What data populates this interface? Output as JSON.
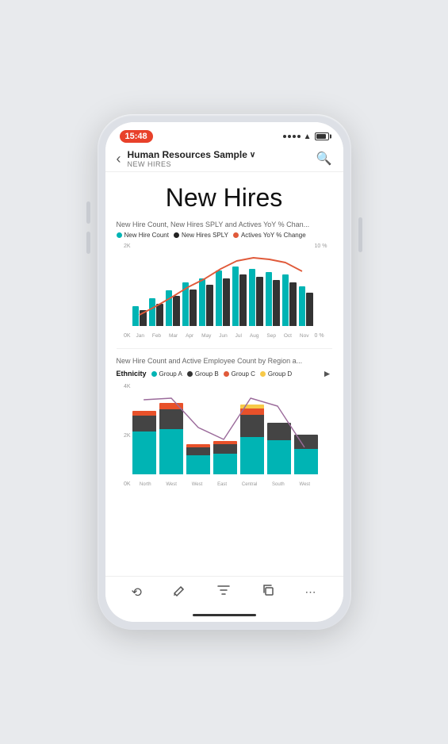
{
  "status": {
    "time": "15:48"
  },
  "nav": {
    "title": "Human Resources Sample",
    "subtitle": "NEW HIRES",
    "back_label": "<",
    "chevron": "∨"
  },
  "page": {
    "title": "New Hires"
  },
  "chart1": {
    "title": "New Hire Count, New Hires SPLY and Actives YoY % Chan...",
    "legend": [
      {
        "label": "New Hire Count",
        "color": "#00b4b4"
      },
      {
        "label": "New Hires SPLY",
        "color": "#222"
      },
      {
        "label": "Actives YoY % Change",
        "color": "#e05a3a"
      }
    ],
    "y_left": [
      "2K",
      "0K"
    ],
    "y_right": [
      "10 %",
      "0 %"
    ],
    "x_labels": [
      "Jan",
      "Feb",
      "Mar",
      "Apr",
      "May",
      "Jun",
      "Jul",
      "Aug",
      "Sep",
      "Oct",
      "Nov"
    ],
    "bars": [
      {
        "teal": 25,
        "dark": 20
      },
      {
        "teal": 35,
        "dark": 28
      },
      {
        "teal": 45,
        "dark": 38
      },
      {
        "teal": 55,
        "dark": 46
      },
      {
        "teal": 60,
        "dark": 52
      },
      {
        "teal": 70,
        "dark": 60
      },
      {
        "teal": 75,
        "dark": 65
      },
      {
        "teal": 72,
        "dark": 62
      },
      {
        "teal": 68,
        "dark": 58
      },
      {
        "teal": 65,
        "dark": 55
      },
      {
        "teal": 50,
        "dark": 42
      }
    ]
  },
  "chart2": {
    "title": "New Hire Count and Active Employee Count by Region a...",
    "legend": [
      {
        "label": "Group A",
        "color": "#00b4b4"
      },
      {
        "label": "Group B",
        "color": "#333"
      },
      {
        "label": "Group C",
        "color": "#e05a3a"
      },
      {
        "label": "Group D",
        "color": "#f7c948"
      }
    ],
    "ethnicity_label": "Ethnicity",
    "y_labels": [
      "4K",
      "2K",
      "0K"
    ],
    "x_labels": [
      "North",
      "West",
      "West",
      "East",
      "Central",
      "South",
      "West"
    ]
  },
  "toolbar": {
    "icons": [
      "undo",
      "pen",
      "filter",
      "copy",
      "more"
    ]
  }
}
